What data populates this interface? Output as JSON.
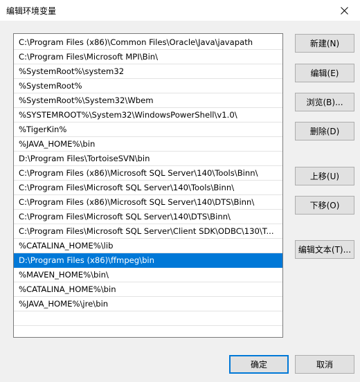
{
  "window": {
    "title": "编辑环境变量"
  },
  "list": {
    "items": [
      "C:\\Program Files (x86)\\Common Files\\Oracle\\Java\\javapath",
      "C:\\Program Files\\Microsoft MPI\\Bin\\",
      "%SystemRoot%\\system32",
      "%SystemRoot%",
      "%SystemRoot%\\System32\\Wbem",
      "%SYSTEMROOT%\\System32\\WindowsPowerShell\\v1.0\\",
      "%TigerKin%",
      "%JAVA_HOME%\\bin",
      "D:\\Program Files\\TortoiseSVN\\bin",
      "C:\\Program Files (x86)\\Microsoft SQL Server\\140\\Tools\\Binn\\",
      "C:\\Program Files\\Microsoft SQL Server\\140\\Tools\\Binn\\",
      "C:\\Program Files (x86)\\Microsoft SQL Server\\140\\DTS\\Binn\\",
      "C:\\Program Files\\Microsoft SQL Server\\140\\DTS\\Binn\\",
      "C:\\Program Files\\Microsoft SQL Server\\Client SDK\\ODBC\\130\\T...",
      "%CATALINA_HOME%\\lib",
      "D:\\Program Files (x86)\\ffmpeg\\bin",
      "%MAVEN_HOME%\\bin\\",
      "%CATALINA_HOME%\\bin",
      "%JAVA_HOME%\\jre\\bin"
    ],
    "selected_index": 15
  },
  "buttons": {
    "new": "新建(N)",
    "edit": "编辑(E)",
    "browse": "浏览(B)...",
    "delete": "删除(D)",
    "move_up": "上移(U)",
    "move_down": "下移(O)",
    "edit_text": "编辑文本(T)...",
    "ok": "确定",
    "cancel": "取消"
  },
  "icons": {
    "close": "close-icon"
  },
  "colors": {
    "selection": "#0078d7",
    "background": "#f0f0f0"
  }
}
